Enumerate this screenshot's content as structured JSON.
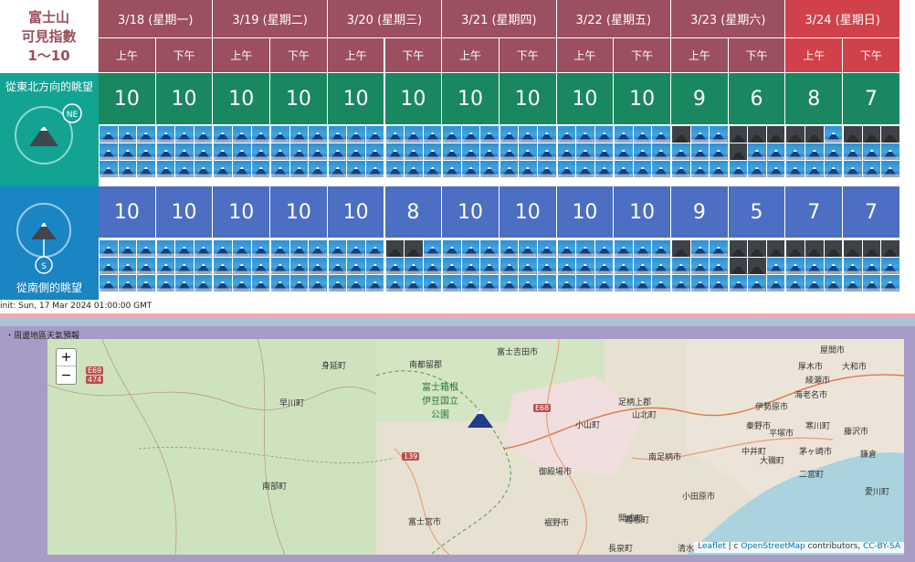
{
  "title": {
    "line1": "富士山",
    "line2": "可見指數",
    "line3": "1〜10"
  },
  "days": [
    {
      "label": "3/18 (星期一)",
      "sunday": false
    },
    {
      "label": "3/19 (星期二)",
      "sunday": false
    },
    {
      "label": "3/20 (星期三)",
      "sunday": false
    },
    {
      "label": "3/21 (星期四)",
      "sunday": false
    },
    {
      "label": "3/22 (星期五)",
      "sunday": false
    },
    {
      "label": "3/23 (星期六)",
      "sunday": false
    },
    {
      "label": "3/24 (星期日)",
      "sunday": true
    }
  ],
  "halves": [
    "上午",
    "下午"
  ],
  "views": {
    "ne": {
      "label": "從東北方向的眺望",
      "compass": "NE",
      "scores": [
        10,
        10,
        10,
        10,
        10,
        10,
        10,
        10,
        10,
        10,
        9,
        6,
        8,
        7
      ]
    },
    "s": {
      "label": "從南側的眺望",
      "compass": "S",
      "scores": [
        10,
        10,
        10,
        10,
        10,
        8,
        10,
        10,
        10,
        10,
        9,
        5,
        7,
        7
      ]
    }
  },
  "init_text": "init: Sun, 17 Mar 2024 01:00:00 GMT",
  "area_title": "・周邊地區天氣預報",
  "map": {
    "zoom_in": "+",
    "zoom_out": "−",
    "park_lines": [
      "富士箱根",
      "伊豆国立",
      "公園"
    ],
    "labels": [
      "富士吉田市",
      "南都留郡",
      "身延町",
      "早川町",
      "南部町",
      "富士宮市",
      "裾野市",
      "御殿場市",
      "小山町",
      "山北町",
      "足柄上郡",
      "南足柄市",
      "開成町",
      "中井町",
      "大磯町",
      "平塚市",
      "伊勢原市",
      "秦野市",
      "厚木市",
      "綾瀬市",
      "大和市",
      "屋間市",
      "海老名市",
      "寒川町",
      "藤沢市",
      "茅ヶ崎市",
      "鎌倉",
      "二宮町",
      "小田原市",
      "箱根町",
      "長泉町",
      "清水町",
      "愛川町"
    ],
    "shields": [
      "E69",
      "474",
      "E68",
      "139"
    ],
    "attribution": {
      "leaflet": "Leaflet",
      "sep": " | c ",
      "osm": "OpenStreetMap",
      "contrib": " contributors, ",
      "license": "CC-BY-SA"
    }
  },
  "colors": {
    "header": "#9c4f5e",
    "sunday": "#d0414a",
    "ne_side": "#13a393",
    "s_side": "#1a85c3",
    "ne_score": "#19875f",
    "s_score": "#4c6ec3",
    "sky": "#2f8fd3",
    "dark": "#3e4147"
  }
}
